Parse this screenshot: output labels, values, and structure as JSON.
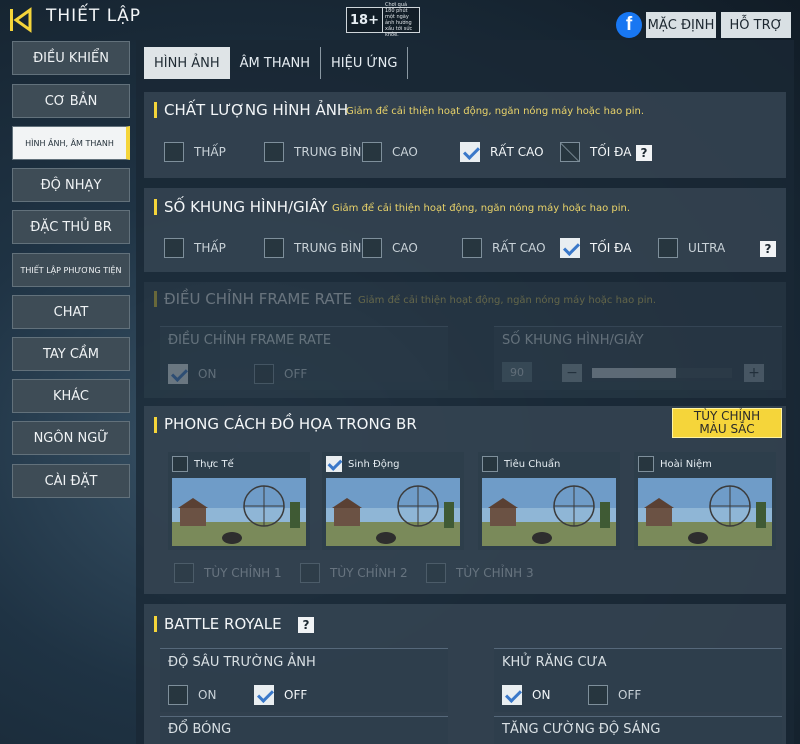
{
  "header": {
    "title": "THIẾT LẬP",
    "age_rating": "18+",
    "age_text": "Chơi quá 180 phút một ngày ảnh hưởng xấu tới sức khỏe.",
    "fb_label": "f",
    "default_label": "MẶC ĐỊNH",
    "support_label": "HỖ TRỢ"
  },
  "sidebar": {
    "items": [
      {
        "label": "ĐIỀU KHIỂN"
      },
      {
        "label": "CƠ BẢN"
      },
      {
        "label": "HÌNH ẢNH, ÂM THANH"
      },
      {
        "label": "ĐỘ NHẠY"
      },
      {
        "label": "ĐẶC THỦ BR"
      },
      {
        "label": "THIẾT LẬP PHƯƠNG TIỆN"
      },
      {
        "label": "CHAT"
      },
      {
        "label": "TAY CẦM"
      },
      {
        "label": "KHÁC"
      },
      {
        "label": "NGÔN NGỮ"
      },
      {
        "label": "CÀI ĐẶT"
      }
    ]
  },
  "tabs": [
    {
      "label": "HÌNH ẢNH"
    },
    {
      "label": "ÂM THANH"
    },
    {
      "label": "HIỆU ỨNG"
    }
  ],
  "quality": {
    "title": "CHẤT LƯỢNG HÌNH ẢNH",
    "desc": "Giảm để cải thiện hoạt động, ngăn nóng máy hoặc hao pin.",
    "options": [
      "THẤP",
      "TRUNG BÌNH",
      "CAO",
      "RẤT CAO",
      "TỐI ĐA"
    ],
    "selected": "RẤT CAO",
    "help": "?"
  },
  "fps": {
    "title": "SỐ KHUNG HÌNH/GIÂY",
    "desc": "Giảm để cải thiện hoạt động, ngăn nóng máy hoặc hao pin.",
    "options": [
      "THẤP",
      "TRUNG BÌNH",
      "CAO",
      "RẤT CAO",
      "TỐI ĐA",
      "ULTRA"
    ],
    "selected": "TỐI ĐA",
    "help": "?"
  },
  "frame_rate": {
    "title": "ĐIỀU CHỈNH FRAME RATE",
    "desc": "Giảm để cải thiện hoạt động, ngăn nóng máy hoặc hao pin.",
    "left_label": "ĐIỀU CHỈNH FRAME RATE",
    "on": "ON",
    "off": "OFF",
    "right_label": "SỐ KHUNG HÌNH/GIÂY",
    "value": "90",
    "minus": "−",
    "plus": "+",
    "level": 0.6
  },
  "style": {
    "title": "PHONG CÁCH ĐỒ HỌA TRONG BR",
    "custom_btn_line1": "TÙY CHỈNH",
    "custom_btn_line2": "MÀU SẮC",
    "cards": [
      "Thực Tế",
      "Sinh Động",
      "Tiêu Chuẩn",
      "Hoài Niệm"
    ],
    "selected": "Sinh Động",
    "custom": [
      "TÙY CHỈNH 1",
      "TÙY CHỈNH 2",
      "TÙY CHỈNH 3"
    ]
  },
  "br": {
    "title": "BATTLE ROYALE",
    "help": "?",
    "dof_label": "ĐỘ SÂU TRƯỜNG ẢNH",
    "dof_on": "ON",
    "dof_off": "OFF",
    "aa_label": "KHỬ RĂNG CƯA",
    "aa_on": "ON",
    "aa_off": "OFF",
    "shadow_label": "ĐỔ BÓNG",
    "brightness_label": "TĂNG CƯỜNG ĐỘ SÁNG"
  },
  "colors": {
    "accent": "#f5d53a",
    "check": "#3a78c9",
    "facebook": "#1877f2"
  }
}
